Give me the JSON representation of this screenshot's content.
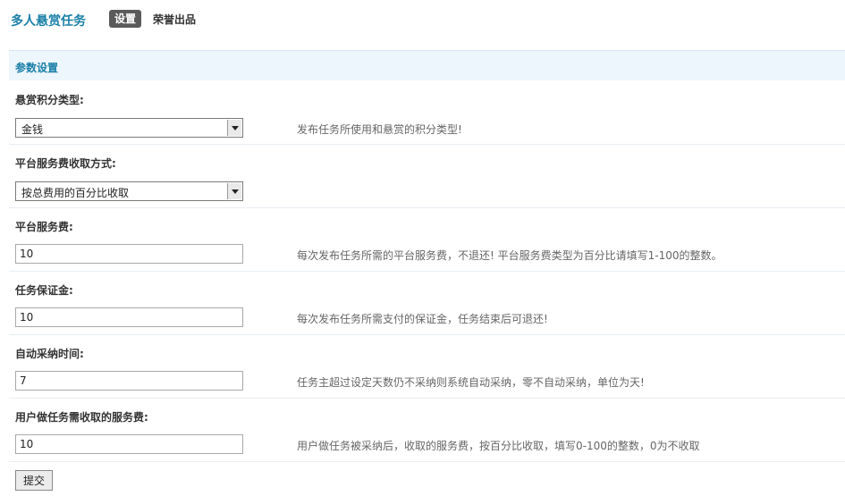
{
  "header": {
    "title": "多人悬赏任务",
    "tab_active": "设置",
    "tab_link": "荣誉出品"
  },
  "section": {
    "title": "参数设置"
  },
  "fields": [
    {
      "label": "悬赏积分类型:",
      "type": "select",
      "value": "金钱",
      "hint": "发布任务所使用和悬赏的积分类型!"
    },
    {
      "label": "平台服务费收取方式:",
      "type": "select",
      "value": "按总费用的百分比收取",
      "hint": ""
    },
    {
      "label": "平台服务费:",
      "type": "input",
      "value": "10",
      "hint": "每次发布任务所需的平台服务费，不退还! 平台服务费类型为百分比请填写1-100的整数。"
    },
    {
      "label": "任务保证金:",
      "type": "input",
      "value": "10",
      "hint": "每次发布任务所需支付的保证金，任务结束后可退还!"
    },
    {
      "label": "自动采纳时间:",
      "type": "input",
      "value": "7",
      "hint": "任务主超过设定天数仍不采纳则系统自动采纳，零不自动采纳，单位为天!"
    },
    {
      "label": "用户做任务需收取的服务费:",
      "type": "input",
      "value": "10",
      "hint": "用户做任务被采纳后，收取的服务费，按百分比收取，填写0-100的整数，0为不收取"
    }
  ],
  "submit_label": "提交",
  "colors": {
    "accent": "#1a7fa8",
    "section_bg": "#eef6fd",
    "tab_bg": "#5a5a5a"
  }
}
